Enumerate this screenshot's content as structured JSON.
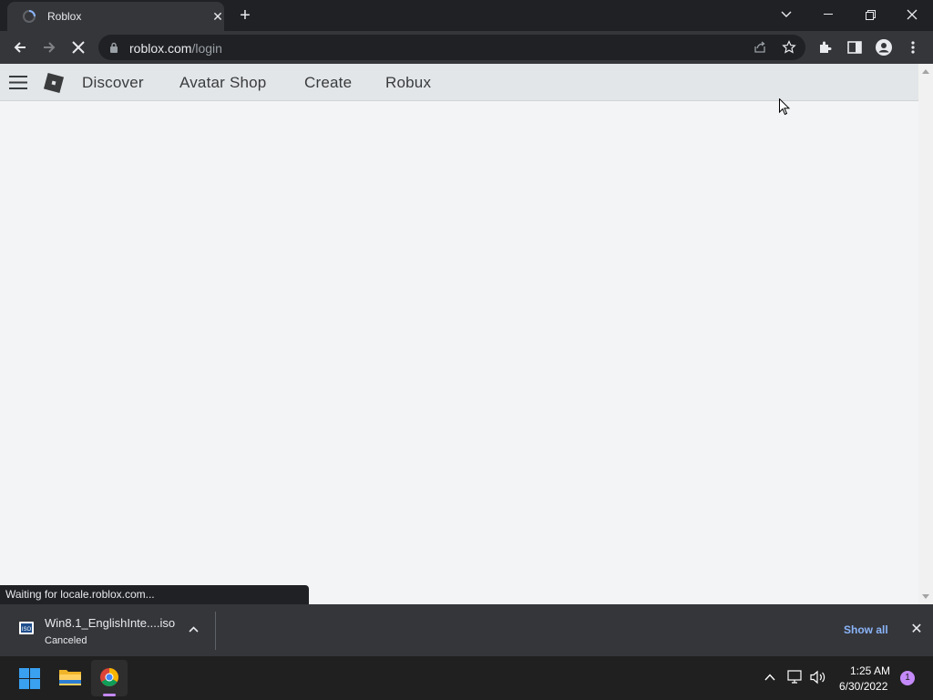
{
  "browser": {
    "tab_title": "Roblox",
    "url_host": "roblox.com",
    "url_path": "/login",
    "status_text": "Waiting for locale.roblox.com..."
  },
  "roblox_nav": {
    "links": [
      "Discover",
      "Avatar Shop",
      "Create",
      "Robux"
    ]
  },
  "download": {
    "file_name": "Win8.1_EnglishInte....iso",
    "status": "Canceled",
    "file_icon_label": "ISO",
    "show_all": "Show all"
  },
  "taskbar": {
    "time": "1:25 AM",
    "date": "6/30/2022",
    "notification_count": "1"
  },
  "colors": {
    "chrome_dark": "#202124",
    "chrome_toolbar": "#35363a",
    "link_blue": "#8ab4f8",
    "page_bg": "#f2f4f5"
  }
}
